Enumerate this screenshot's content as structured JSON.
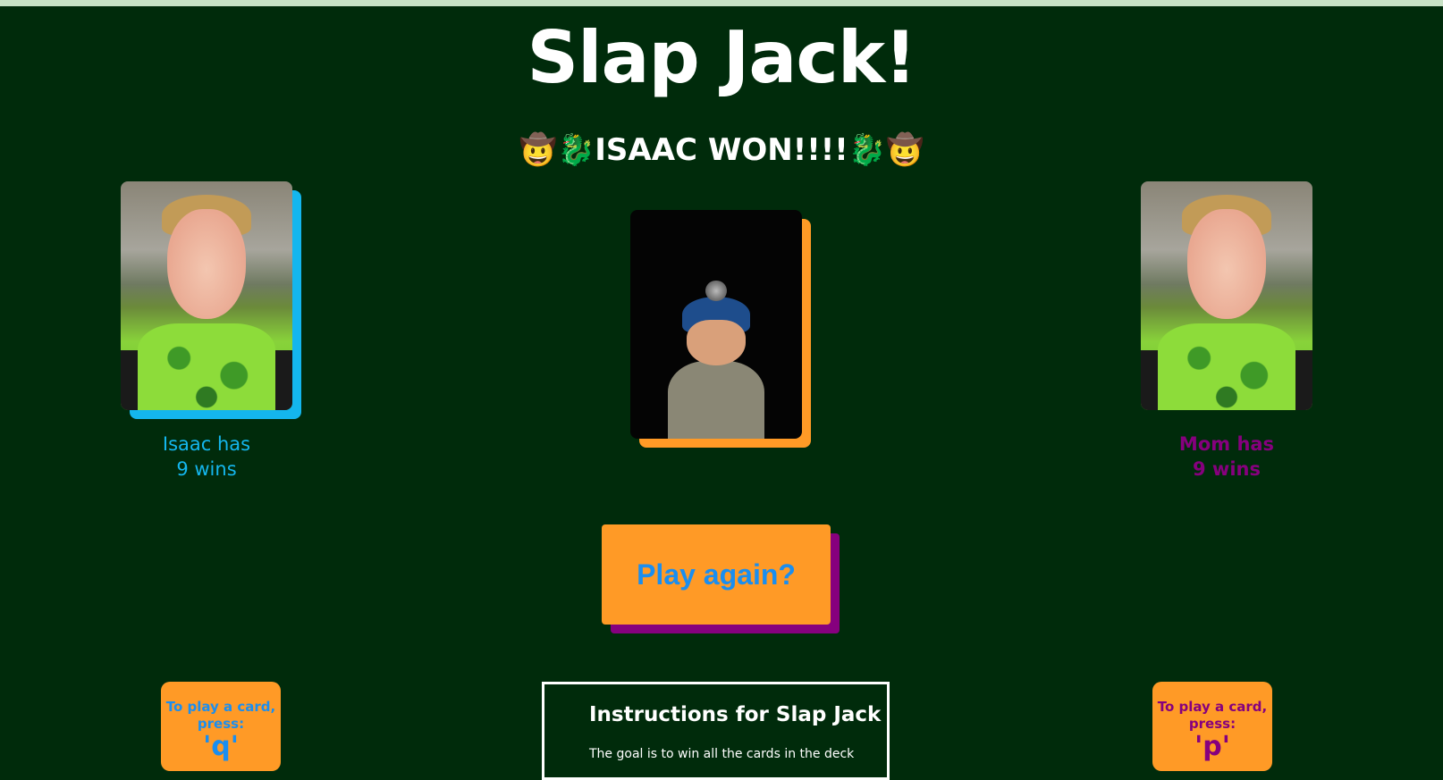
{
  "title": "Slap Jack!",
  "status": {
    "winner_message": "🤠🐉ISAAC WON!!!!🐉🤠"
  },
  "players": {
    "isaac": {
      "label_line1": "Isaac has",
      "label_line2": "9 wins",
      "color": "#14b6ee",
      "card_shadow_color": "#14b6ee"
    },
    "mom": {
      "label_line1": "Mom has",
      "label_line2": "9 wins",
      "color": "#86007e"
    }
  },
  "center_pile": {
    "card_shadow_color": "#ff9a26"
  },
  "play_again": {
    "label": "Play again?"
  },
  "keys": {
    "left": {
      "prompt": "To play a card, press:",
      "key": "'q'"
    },
    "right": {
      "prompt": "To play a card, press:",
      "key": "'p'"
    }
  },
  "instructions": {
    "heading": "Instructions for Slap Jack",
    "text": "The goal is to win all the cards in the deck"
  },
  "colors": {
    "background": "#002b0b",
    "accent_orange": "#ff9a26",
    "accent_blue": "#1a8ef0",
    "accent_purple": "#86007e",
    "top_bar": "#c8e2c6"
  }
}
